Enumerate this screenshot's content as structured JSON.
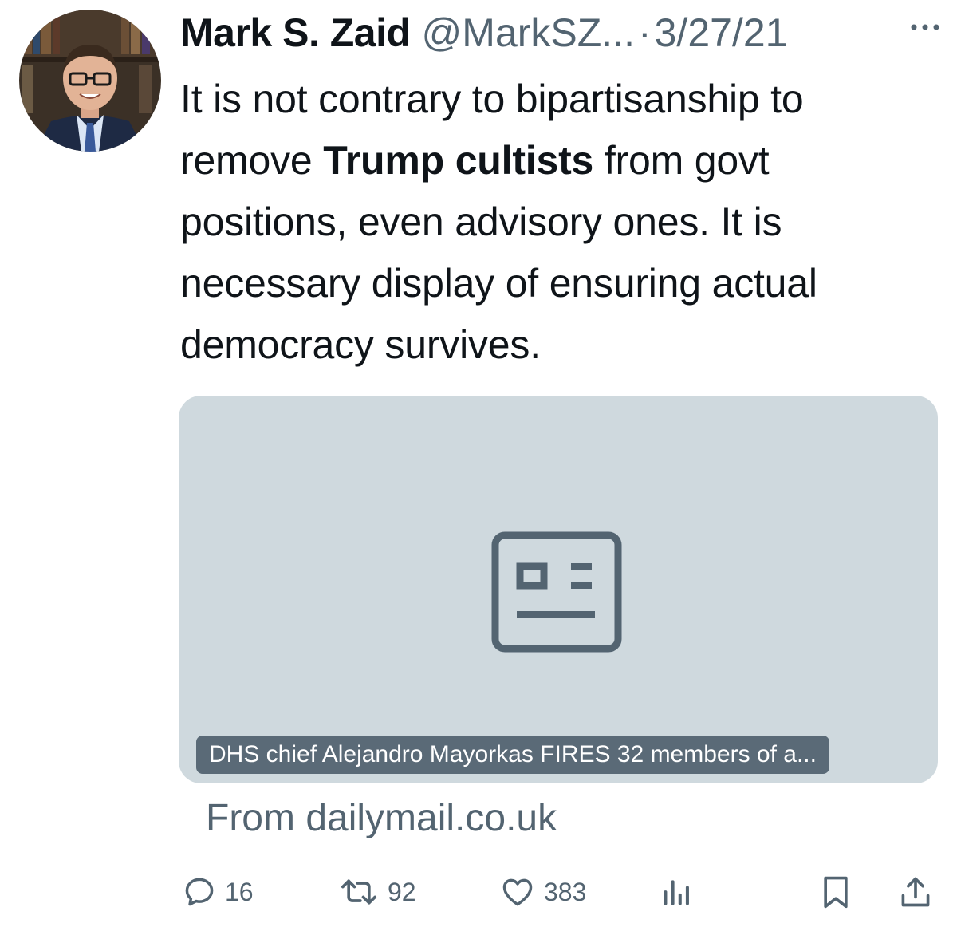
{
  "tweet": {
    "author_name": "Mark S. Zaid",
    "handle": "@MarkSZ...",
    "separator": "·",
    "date": "3/27/21",
    "text_part1": "It is not contrary to bipartisanship to remove ",
    "text_bold": "Trump cultists",
    "text_part2": " from govt positions, even advisory ones. It is necessary display of ensuring actual democracy survives."
  },
  "card": {
    "title": "DHS chief Alejandro Mayorkas FIRES 32 members of a...",
    "source": "From dailymail.co.uk",
    "icon": "article-icon"
  },
  "actions": {
    "replies": "16",
    "retweets": "92",
    "likes": "383"
  },
  "icons": {
    "more": "more-icon",
    "reply": "reply-icon",
    "retweet": "retweet-icon",
    "like": "heart-icon",
    "views": "views-icon",
    "bookmark": "bookmark-icon",
    "share": "share-icon"
  },
  "colors": {
    "text": "#0f1419",
    "secondary": "#536471",
    "card_bg": "#cfd9de"
  }
}
